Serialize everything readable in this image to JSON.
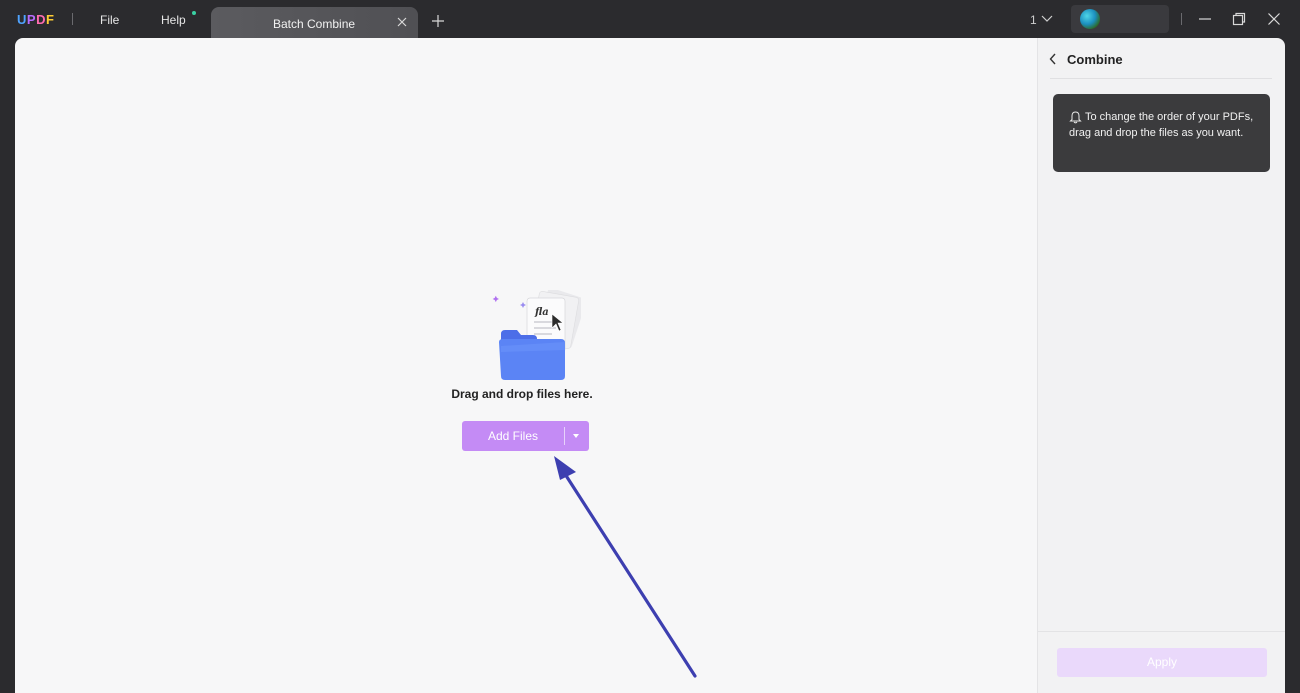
{
  "titlebar": {
    "logo": [
      "U",
      "P",
      "D",
      "F"
    ],
    "menu_file": "File",
    "menu_help": "Help",
    "tab_title": "Batch Combine",
    "page_count": "1"
  },
  "main": {
    "drop_text": "Drag and drop files here.",
    "add_files_label": "Add Files"
  },
  "panel": {
    "title": "Combine",
    "tip": "To change the order of your PDFs, drag and drop the files as you want.",
    "apply_label": "Apply"
  },
  "colors": {
    "accent": "#c48bf5",
    "apply_disabled": "#ead9fb",
    "titlebar_bg": "#2b2b2e",
    "tip_bg": "#3b3b3d",
    "annotation_arrow": "#3d3fb0"
  },
  "icons": {
    "tab_close": "close-icon",
    "tab_add": "plus-icon",
    "page_chevron": "chevron-down-icon",
    "minimize": "minimize-icon",
    "restore": "restore-icon",
    "close_window": "close-icon",
    "back": "chevron-left-icon",
    "tip": "bell-icon",
    "dropdown": "caret-down-icon",
    "illustration": "folder-documents-icon"
  }
}
